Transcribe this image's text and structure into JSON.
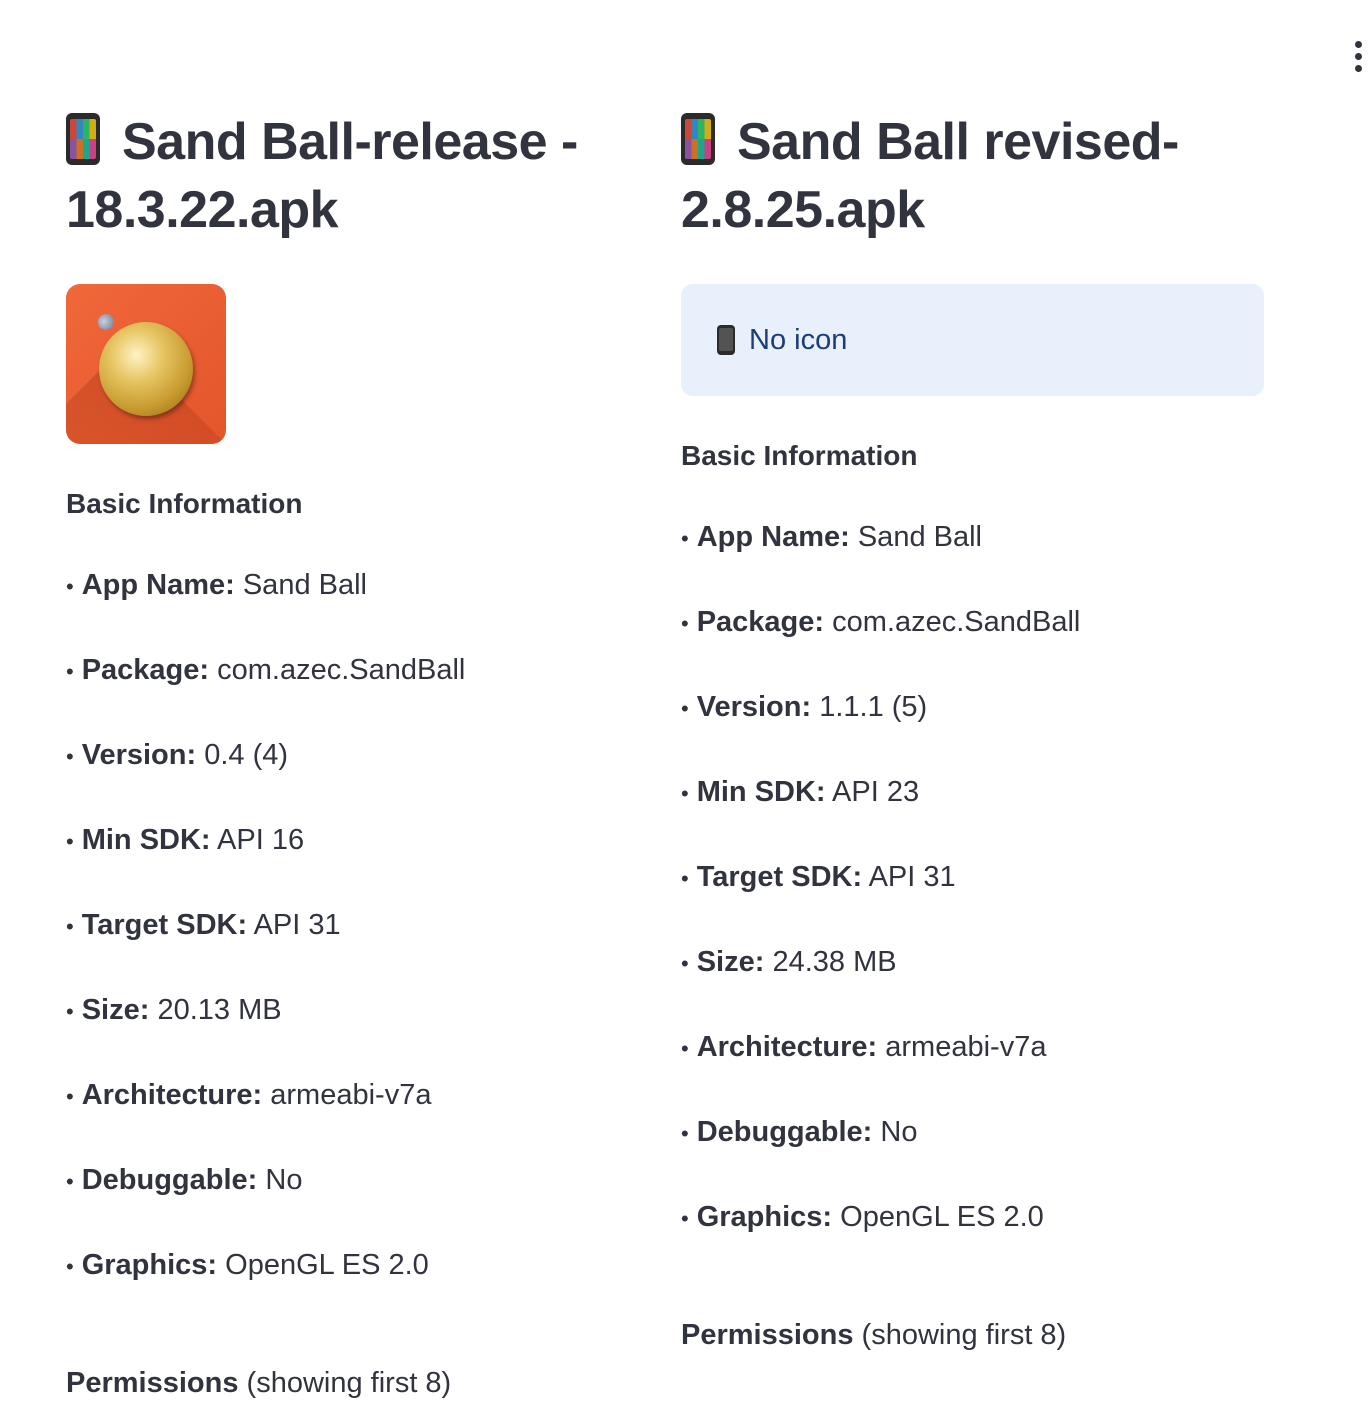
{
  "apps": [
    {
      "title": "Sand Ball-release - 18.3.22.apk",
      "title_line1": "Sand Ball-release -",
      "title_line2": "18.3.22.apk",
      "has_icon": true,
      "no_icon_text": "",
      "basic_info_title": "Basic Information",
      "info": [
        {
          "key": "App Name:",
          "value": "Sand Ball"
        },
        {
          "key": "Package:",
          "value": "com.azec.SandBall"
        },
        {
          "key": "Version:",
          "value": "0.4 (4)"
        },
        {
          "key": "Min SDK:",
          "value": "API 16"
        },
        {
          "key": "Target SDK:",
          "value": "API 31"
        },
        {
          "key": "Size:",
          "value": "20.13 MB"
        },
        {
          "key": "Architecture:",
          "value": "armeabi-v7a"
        },
        {
          "key": "Debuggable:",
          "value": "No"
        },
        {
          "key": "Graphics:",
          "value": "OpenGL ES 2.0"
        }
      ],
      "permissions_label": "Permissions",
      "permissions_note": "(showing first 8)"
    },
    {
      "title": "Sand Ball revised-2.8.25.apk",
      "title_line1": "Sand Ball revised-",
      "title_line2": "2.8.25.apk",
      "has_icon": false,
      "no_icon_text": "No icon",
      "basic_info_title": "Basic Information",
      "info": [
        {
          "key": "App Name:",
          "value": "Sand Ball"
        },
        {
          "key": "Package:",
          "value": "com.azec.SandBall"
        },
        {
          "key": "Version:",
          "value": "1.1.1 (5)"
        },
        {
          "key": "Min SDK:",
          "value": "API 23"
        },
        {
          "key": "Target SDK:",
          "value": "API 31"
        },
        {
          "key": "Size:",
          "value": "24.38 MB"
        },
        {
          "key": "Architecture:",
          "value": "armeabi-v7a"
        },
        {
          "key": "Debuggable:",
          "value": "No"
        },
        {
          "key": "Graphics:",
          "value": "OpenGL ES 2.0"
        }
      ],
      "permissions_label": "Permissions",
      "permissions_note": "(showing first 8)"
    }
  ],
  "colors": {
    "text": "#31333f",
    "info_box_bg": "#e8f0fb",
    "info_box_text": "#1c3d7a",
    "icon_bg": "#e9592e"
  },
  "icons": {
    "main_menu": "kebab-menu-icon",
    "title_glyph": "mobile-phone-icon",
    "app_icon": "sand-ball-app-icon"
  }
}
